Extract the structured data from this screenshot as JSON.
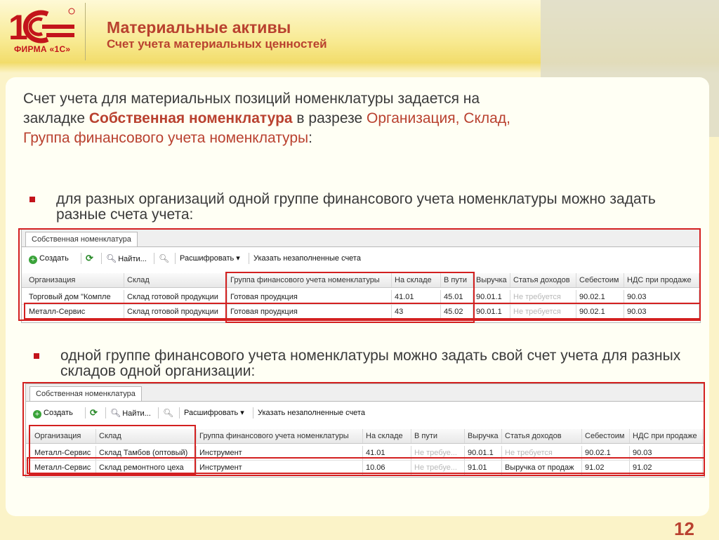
{
  "header": {
    "logo_text": "1С",
    "logo_caption": "ФИРМА «1С»",
    "title": "Материальные активы",
    "subtitle": "Счет учета материальных ценностей"
  },
  "intro": {
    "p1": "Счет учета для материальных позиций номенклатуры задается на закладке ",
    "tab_name": "Собственная номенклатура",
    "p2": " в разрезе ",
    "dims": "Организация, Склад, Группа финансового учета номенклатуры",
    "p3": ":"
  },
  "bullets": {
    "b1": "для разных организаций одной группе финансового учета номенклатуры можно задать разные счета учета:",
    "b2": "одной группе финансового учета номенклатуры можно задать свой счет учета для разных складов одной организации:"
  },
  "toolbar": {
    "create": "Создать",
    "find": "Найти...",
    "decode": "Расшифровать",
    "fill_empty": "Указать незаполненные счета"
  },
  "table1": {
    "tab_label": "Собственная номенклатура",
    "headers": [
      "Организация",
      "Склад",
      "Группа финансового учета номенклатуры",
      "На складе",
      "В пути",
      "Выручка",
      "Статья доходов",
      "Себестоим",
      "НДС при продаже"
    ],
    "rows": [
      [
        "Торговый дом \"Компле",
        "Склад готовой продукции",
        "Готовая проудкция",
        "41.01",
        "45.01",
        "90.01.1",
        "Не требуется",
        "90.02.1",
        "90.03"
      ],
      [
        "Металл-Сервис",
        "Склад готовой продукции",
        "Готовая проудкция",
        "43",
        "45.02",
        "90.01.1",
        "Не требуется",
        "90.02.1",
        "90.03"
      ]
    ]
  },
  "table2": {
    "tab_label": "Собственная номенклатура",
    "headers": [
      "Организация",
      "Склад",
      "Группа финансового учета номенклатуры",
      "На складе",
      "В пути",
      "Выручка",
      "Статья доходов",
      "Себестоим",
      "НДС при продаже"
    ],
    "rows": [
      [
        "Металл-Сервис",
        "Склад Тамбов (оптовый)",
        "Инструмент",
        "41.01",
        "Не требуе...",
        "90.01.1",
        "Не требуется",
        "90.02.1",
        "90.03"
      ],
      [
        "Металл-Сервис",
        "Склад ремонтного цеха",
        "Инструмент",
        "10.06",
        "Не требуе...",
        "91.01",
        "Выручка от продаж",
        "91.02",
        "91.02"
      ]
    ]
  },
  "page_number": "12"
}
